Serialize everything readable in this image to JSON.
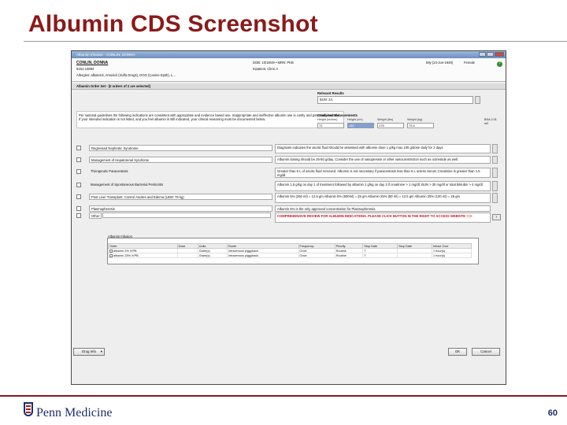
{
  "slide": {
    "title": "Albumin CDS Screenshot",
    "page_number": "60",
    "logo_text": "Penn Medicine"
  },
  "window": {
    "title": "Albumin Infusion - CONLIN, DONNA",
    "patient": {
      "name": "CONLIN, DONNA",
      "mrn": "5151-13894",
      "allergies": "Allergies: albuterol, Amoxicil (Sulfa Drugs), DOG (Canine Epith), L...",
      "dob": "DOB: 10/18/49 • MRN: PKB",
      "location": "Inpatient, Clinic A",
      "age": "59y (24-Jun-1949)",
      "sex": "Female"
    },
    "order_set_title": "Albumin Order Set - [0 orders of 2 are selected]",
    "guidelines": "Per national guidelines the following indications are consistent with appropriate and evidence based use. Inappropriate and ineffective albumin use is costly and potentially harmful. If your intended indication is not listed, and you feel albumin is still indicated, your clinical reasoning must be documented below.",
    "relevant_results": {
      "label": "Relevant Results",
      "value": "BUN: 24,"
    },
    "measurements": {
      "label": "Combined Measurements",
      "height_inches_label": "Height (inches)",
      "height_inches": "72",
      "height_cm_label": "Height (cm)",
      "height_cm": "182",
      "weight_lbs_label": "Weight (lbs)",
      "weight_lbs": "175",
      "weight_kg_label": "Weight (kg)",
      "weight_kg": "79.4",
      "bsa_label": "BSA",
      "bsa": "2.01 m2"
    },
    "indications": [
      {
        "label": "Regressed Nephrotic Syndrome",
        "description": "Diagnosis indicates the ascitic fluid should be assessed with albumin dose 1 g/kg max 100 g/dose daily for 2 days"
      },
      {
        "label": "Management of Hepatorenal Syndrome",
        "description": "Albumin dosing should be 25-50 g/day. Consider the use of vasopressin or other vasoconstriction such as octreotide as well."
      },
      {
        "label": "Therapeutic Paracentesis",
        "description": "Greater than 5 L of ascitic fluid removed. Albumin is not necessary if paracentesis less than 5 L unless Serum Creatinine is greater than 1.5 mg/dl."
      },
      {
        "label": "Management of Spontaneous Bacterial Peritonitis",
        "description": "Albumin 1.5 g/kg on day 1 of treatment followed by albumin 1 g/kg on day 3 if creatinine > 1 mg/dl, BUN > 30 mg/dl or total bilirubin > 4 mg/dl."
      },
      {
        "label": "Post Liver Transplant: Control Ascites and Edema (LBW: 78 kg)",
        "description": "Albumin 5% (250 ml) = 12.5 gm   Albumin 5% (500ml) = 25 gm   Albumin 25% (50 ml) = 12.5 gm   Albumin 25% (100 ml) = 25 gm"
      },
      {
        "label": "Plasmapheresis",
        "description": "Albumin 5% is the only approved concentration for Plasmapheresis."
      }
    ],
    "other": {
      "label": "Other",
      "description": "COMPREHENSIVE REVIEW FOR ALBUMIN INDICATIONS. PLEASE CLICK BUTTON IN THE RIGHT TO ACCESS WEBSITE ==>",
      "button": "›"
    },
    "orders_section": {
      "label": "Albumin Infusion",
      "columns": [
        "Order",
        "Dose",
        "Units",
        "Route",
        "Frequency",
        "Priority",
        "Stop Date",
        "Stop Date",
        "Infuse Over"
      ],
      "rows": [
        [
          "albumin 5% IVPB",
          "",
          "Gram(s)",
          "Intravenous piggyback",
          "Once",
          "Routine",
          "T",
          "",
          "1 hour(s)"
        ],
        [
          "albumin 25% IVPB",
          "",
          "Gram(s)",
          "Intravenous piggyback",
          "Once",
          "Routine",
          "T",
          "",
          "1 hour(s)"
        ]
      ]
    },
    "buttons": {
      "dropdown": "Drug Info",
      "ok": "OK",
      "cancel": "Cancel"
    }
  }
}
